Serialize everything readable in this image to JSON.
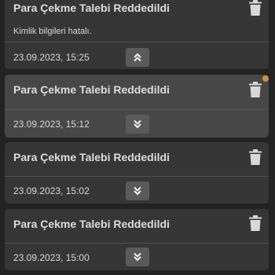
{
  "colors": {
    "background": "#232323",
    "card": "#363636",
    "card_selected": "#474747",
    "toggle": "#5a5a5a",
    "text": "#d8d8d8",
    "unread_dot": "#c8923a"
  },
  "notifications": [
    {
      "title": "Para Çekme Talebi Reddedildi",
      "message": "Kimlik bilgileri hatalı.",
      "time": "23.09.2023, 15:25",
      "expanded": true,
      "toggle_icon": "chevrons-up-icon",
      "delete_icon": "trash-icon"
    },
    {
      "title": "Para Çekme Talebi Reddedildi",
      "time": "23.09.2023, 15:12",
      "expanded": false,
      "unread": true,
      "toggle_icon": "chevrons-down-icon",
      "delete_icon": "trash-icon"
    },
    {
      "title": "Para Çekme Talebi Reddedildi",
      "time": "23.09.2023, 15:02",
      "expanded": false,
      "toggle_icon": "chevrons-down-icon",
      "delete_icon": "trash-icon"
    },
    {
      "title": "Para Çekme Talebi Reddedildi",
      "time": "23.09.2023, 15:00",
      "expanded": false,
      "toggle_icon": "chevrons-down-icon",
      "delete_icon": "trash-icon"
    }
  ]
}
